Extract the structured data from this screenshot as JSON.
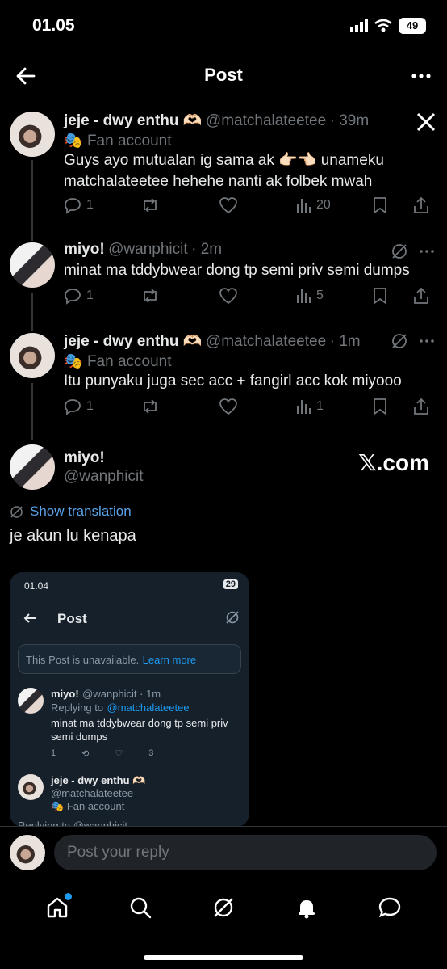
{
  "status_bar": {
    "time": "01.05",
    "battery": "49"
  },
  "header": {
    "title": "Post"
  },
  "posts": [
    {
      "name": "jeje - dwy enthu 🫶🏻",
      "handle": "@matchalateetee",
      "time": "· 39m",
      "badge": "Fan account",
      "text_line1": "Guys ayo mutualan ig sama ak 👉🏻👈🏻 unameku",
      "text_line2": "matchalateetee hehehe nanti ak folbek mwah",
      "replies": "1",
      "views": "20"
    },
    {
      "name": "miyo!",
      "handle": "@wanphicit",
      "time": "· 2m",
      "text": "minat ma tddybwear dong tp semi priv semi dumps",
      "replies": "1",
      "views": "5"
    },
    {
      "name": "jeje - dwy enthu 🫶🏻",
      "handle": "@matchalateetee",
      "time": "· 1m",
      "badge": "Fan account",
      "text": "Itu punyaku juga sec acc + fangirl acc kok miyooo",
      "replies": "1",
      "views": "1"
    }
  ],
  "main_post": {
    "name": "miyo!",
    "handle": "@wanphicit",
    "watermark": "𝕏.com",
    "show_translation": "Show translation",
    "text": "je akun lu kenapa"
  },
  "screenshot": {
    "time": "01.04",
    "battery": "29",
    "title": "Post",
    "unavailable_text": "This Post is unavailable.",
    "learn_more": "Learn more",
    "reply_name": "miyo!",
    "reply_handle": "@wanphicit · 1m",
    "replying_to_label": "Replying to",
    "replying_to_handle": "@matchalateetee",
    "reply_text_line1": "minat ma tddybwear dong tp semi priv",
    "reply_text_line2": "semi dumps",
    "reply_replies": "1",
    "reply_views": "3",
    "second_name": "jeje - dwy enthu 🫶🏻",
    "second_handle": "@matchalateetee",
    "second_badge": "Fan account",
    "cut_text": "Replying to @wanphicit"
  },
  "reply": {
    "placeholder": "Post your reply"
  },
  "nav": [
    "home-icon",
    "search-icon",
    "grok-icon",
    "notifications-icon",
    "messages-icon"
  ]
}
